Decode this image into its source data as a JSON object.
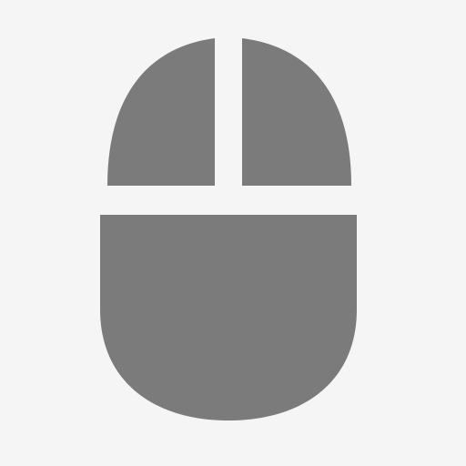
{
  "icon": {
    "name": "mouse-icon",
    "background_color": "#f5f5f5",
    "fill_color": "#7b7b7b"
  }
}
